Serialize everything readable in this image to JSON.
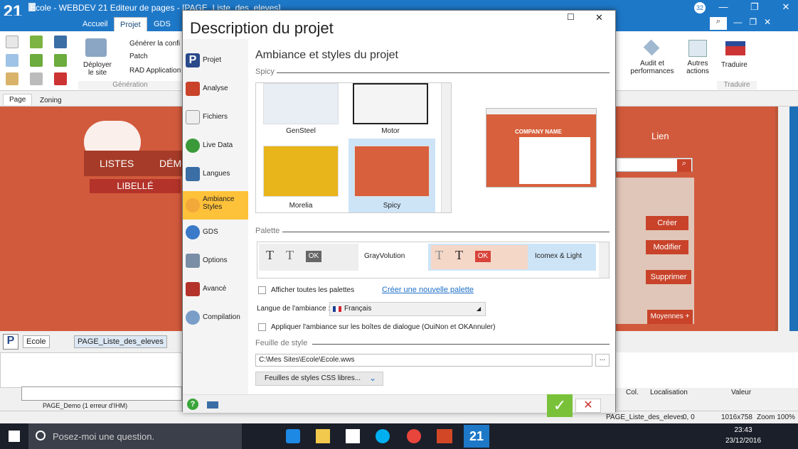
{
  "app": {
    "logo": "21",
    "title": "Ecole - WEBDEV 21  Editeur de pages - [PAGE_Liste_des_eleves]",
    "badge": "32"
  },
  "tabs": [
    "Accueil",
    "Projet",
    "GDS"
  ],
  "ribbon": {
    "deploy": "Déployer le site",
    "generate": "Générer la confi",
    "patch": "Patch",
    "rad": "RAD Application",
    "group_generation": "Génération",
    "audit": "Audit et performances",
    "autres": "Autres actions",
    "traduire": "Traduire",
    "group_traduire": "Traduire"
  },
  "editor": {
    "tab_page": "Page",
    "tab_zoning": "Zoning",
    "nav_listes": "LISTES",
    "nav_demo": "DÉMO",
    "libelle": "LIBELLÉ",
    "lien": "Lien",
    "btn_creer": "Créer",
    "btn_modifier": "Modifier",
    "btn_supprimer": "Supprimer",
    "btn_moyennes": "Moyennes +"
  },
  "bottom": {
    "tab1": "Ecole",
    "tab2": "PAGE_Liste_des_eleves",
    "tree_item": "PAGE_Demo (1 erreur d'IHM)",
    "col": "Col.",
    "localisation": "Localisation",
    "valeur": "Valeur"
  },
  "status": {
    "page": "PAGE_Liste_des_eleves",
    "coords": "0, 0",
    "size": "1016x758",
    "zoom": "Zoom 100%"
  },
  "taskbar": {
    "search": "Posez-moi une question.",
    "time": "23:43",
    "date": "23/12/2016"
  },
  "dialog": {
    "title": "Description du projet",
    "nav": [
      "Projet",
      "Analyse",
      "Fichiers",
      "Live Data",
      "Langues",
      "Ambiance Styles",
      "GDS",
      "Options",
      "Avancé",
      "Compilation"
    ],
    "heading": "Ambiance et styles du projet",
    "section_spicy": "Spicy",
    "themes": [
      "GenSteel",
      "Motor",
      "Morelia",
      "Spicy"
    ],
    "preview_company": "COMPANY NAME",
    "section_palette": "Palette",
    "palettes": [
      "GrayVolution",
      "Icomex & Light"
    ],
    "palette_ok": "OK",
    "palette_t": "T",
    "show_all_palettes": "Afficher toutes les palettes",
    "create_palette": "Créer une nouvelle palette",
    "lang_label": "Langue de l'ambiance :",
    "lang_value": "Français",
    "apply_dialogs": "Appliquer l'ambiance sur les boîtes de dialogue (OuiNon et OKAnnuler)",
    "section_style": "Feuille de style",
    "style_path": "C:\\Mes Sites\\Ecole\\Ecole.wws",
    "browse": "...",
    "css_button": "Feuilles de styles CSS libres..."
  },
  "colors": {
    "accent": "#fec13a",
    "spicy": "#c8432a",
    "ok_green": "#7ac13a"
  }
}
